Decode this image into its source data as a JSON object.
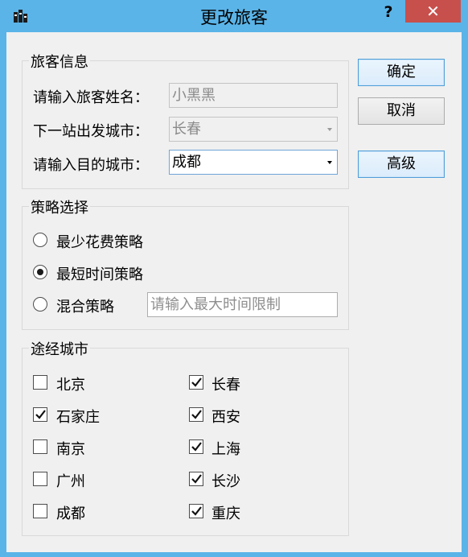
{
  "window": {
    "title": "更改旅客",
    "help": "?",
    "close": "✕",
    "icon": "app-grid-icon"
  },
  "traveler_info": {
    "title": "旅客信息",
    "name_label": "请输入旅客姓名：",
    "name_value": "小黑黑",
    "departure_label": "下一站出发城市：",
    "departure_value": "长春",
    "destination_label": "请输入目的城市：",
    "destination_value": "成都"
  },
  "buttons": {
    "ok": "确定",
    "cancel": "取消",
    "advanced": "高级"
  },
  "strategy": {
    "title": "策略选择",
    "options": [
      {
        "label": "最少花费策略",
        "selected": false
      },
      {
        "label": "最短时间策略",
        "selected": true
      },
      {
        "label": "混合策略",
        "selected": false
      }
    ],
    "time_limit_placeholder": "请输入最大时间限制"
  },
  "via_cities": {
    "title": "途经城市",
    "left": [
      {
        "label": "北京",
        "checked": false
      },
      {
        "label": "石家庄",
        "checked": true
      },
      {
        "label": "南京",
        "checked": false
      },
      {
        "label": "广州",
        "checked": false
      },
      {
        "label": "成都",
        "checked": false
      }
    ],
    "right": [
      {
        "label": "长春",
        "checked": true
      },
      {
        "label": "西安",
        "checked": true
      },
      {
        "label": "上海",
        "checked": true
      },
      {
        "label": "长沙",
        "checked": true
      },
      {
        "label": "重庆",
        "checked": true
      }
    ]
  }
}
